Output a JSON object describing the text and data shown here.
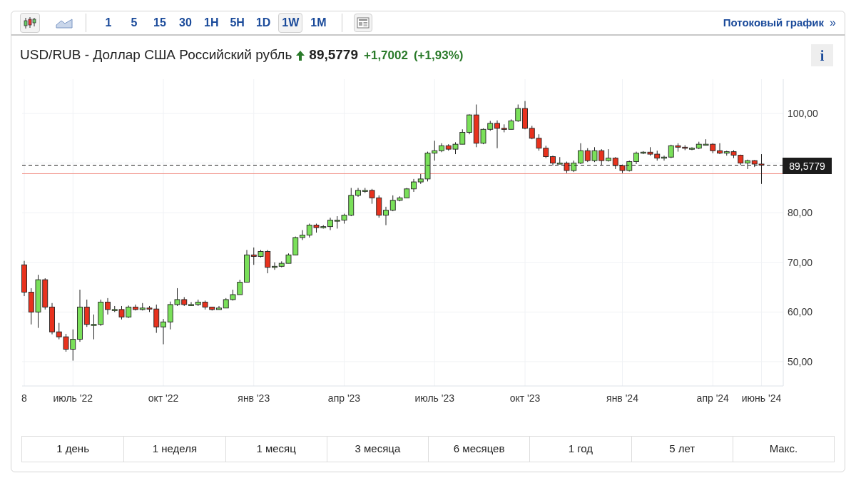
{
  "toolbar": {
    "chart_types": [
      {
        "kind": "candles",
        "selected": true
      },
      {
        "kind": "area",
        "selected": false
      }
    ],
    "intervals": [
      {
        "label": "1",
        "selected": false
      },
      {
        "label": "5",
        "selected": false
      },
      {
        "label": "15",
        "selected": false
      },
      {
        "label": "30",
        "selected": false
      },
      {
        "label": "1H",
        "selected": false
      },
      {
        "label": "5H",
        "selected": false
      },
      {
        "label": "1D",
        "selected": false
      },
      {
        "label": "1W",
        "selected": true
      },
      {
        "label": "1M",
        "selected": false
      }
    ],
    "streaming_link": {
      "label": "Потоковый график",
      "arrow": "»"
    }
  },
  "header": {
    "title": "USD/RUB - Доллар США Российский рубль",
    "rising": true,
    "price": "89,5779",
    "change": "+1,7002",
    "change_percent": "(+1,93%)",
    "info": "i"
  },
  "chart": {
    "price_label": "89,5779",
    "chart_data": {
      "type": "candlestick",
      "ylim": [
        45.1,
        106.9
      ],
      "grid": true,
      "ref_lines": [
        {
          "axis": "y",
          "value": 89.5779,
          "color": "#222222"
        },
        {
          "axis": "y",
          "value": 87.86,
          "color": "#f08a80"
        }
      ],
      "yticks": [
        {
          "value": 100,
          "label": "100,00"
        },
        {
          "value": 80,
          "label": "80,00"
        },
        {
          "value": 70,
          "label": "70,00"
        },
        {
          "value": 60,
          "label": "60,00"
        },
        {
          "value": 50,
          "label": "50,00"
        }
      ],
      "categories": [
        "8",
        null,
        null,
        null,
        null,
        null,
        null,
        "июль '22",
        null,
        null,
        null,
        null,
        null,
        null,
        null,
        null,
        null,
        null,
        null,
        null,
        "окт '22",
        null,
        null,
        null,
        null,
        null,
        null,
        null,
        null,
        null,
        null,
        null,
        null,
        "янв '23",
        null,
        null,
        null,
        null,
        null,
        null,
        null,
        null,
        null,
        null,
        null,
        null,
        "апр '23",
        null,
        null,
        null,
        null,
        null,
        null,
        null,
        null,
        null,
        null,
        null,
        null,
        "июль '23",
        null,
        null,
        null,
        null,
        null,
        null,
        null,
        null,
        null,
        null,
        null,
        null,
        "окт '23",
        null,
        null,
        null,
        null,
        null,
        null,
        null,
        null,
        null,
        null,
        null,
        null,
        null,
        "янв '24",
        null,
        null,
        null,
        null,
        null,
        null,
        null,
        null,
        null,
        null,
        null,
        null,
        "апр '24",
        null,
        null,
        null,
        null,
        null,
        null,
        "июнь '24"
      ],
      "ohlc": [
        [
          69.5,
          70.3,
          63.2,
          64
        ],
        [
          64,
          64.8,
          57.5,
          60
        ],
        [
          60,
          67.5,
          56.8,
          66.5
        ],
        [
          66.5,
          66.8,
          60.5,
          61
        ],
        [
          61,
          61.8,
          55.5,
          56
        ],
        [
          56,
          57.8,
          54.5,
          55
        ],
        [
          55,
          55.6,
          52,
          52.5
        ],
        [
          52.5,
          56.5,
          50.2,
          54.5
        ],
        [
          54.5,
          64.5,
          54,
          61
        ],
        [
          61,
          62.5,
          57,
          57.5
        ],
        [
          57.5,
          59.5,
          54.5,
          57.5
        ],
        [
          57.5,
          62.5,
          57.2,
          62
        ],
        [
          62,
          62.8,
          59.5,
          60.5
        ],
        [
          60.5,
          61.2,
          60,
          60.5
        ],
        [
          60.5,
          61.2,
          58.5,
          59
        ],
        [
          59,
          61.3,
          58.8,
          61
        ],
        [
          61,
          61.5,
          60.3,
          60.5
        ],
        [
          60.5,
          61.8,
          60.3,
          60.8
        ],
        [
          60.8,
          61.2,
          60,
          60.6
        ],
        [
          60.6,
          61.5,
          55.8,
          57
        ],
        [
          57,
          58.6,
          53.5,
          58
        ],
        [
          58,
          62.1,
          56.5,
          61.5
        ],
        [
          61.5,
          64.8,
          61.2,
          62.5
        ],
        [
          62.5,
          63,
          61.2,
          61.5
        ],
        [
          61.5,
          62,
          61.2,
          61.5
        ],
        [
          61.5,
          62.5,
          61.2,
          62
        ],
        [
          62,
          62.3,
          60.5,
          61
        ],
        [
          61,
          61,
          60.3,
          60.5
        ],
        [
          60.5,
          61.2,
          60.5,
          60.8
        ],
        [
          60.8,
          62.8,
          60.8,
          62.5
        ],
        [
          62.5,
          64.5,
          62.3,
          63.5
        ],
        [
          63.5,
          66.5,
          63.5,
          66
        ],
        [
          66,
          72.5,
          66,
          71.5
        ],
        [
          71.5,
          73,
          69.5,
          71.2
        ],
        [
          71.2,
          72.5,
          71,
          72.2
        ],
        [
          72.2,
          72.5,
          67.8,
          69
        ],
        [
          69,
          70,
          68.5,
          69.2
        ],
        [
          69.2,
          70.2,
          69,
          69.8
        ],
        [
          69.8,
          71.8,
          69.8,
          71.5
        ],
        [
          71.5,
          75.2,
          71.5,
          75
        ],
        [
          75,
          76.5,
          74.5,
          75.5
        ],
        [
          75.5,
          77.8,
          75,
          77.5
        ],
        [
          77.5,
          77.8,
          76,
          77
        ],
        [
          77,
          77.5,
          76.8,
          77.2
        ],
        [
          77.2,
          79,
          76.5,
          78.5
        ],
        [
          78.5,
          79.3,
          76.8,
          78.5
        ],
        [
          78.5,
          79.8,
          77.8,
          79.5
        ],
        [
          79.5,
          85,
          79.3,
          83.5
        ],
        [
          83.5,
          85,
          83.2,
          84.5
        ],
        [
          84.5,
          85,
          84,
          84.5
        ],
        [
          84.5,
          84.8,
          81.8,
          83
        ],
        [
          83,
          83.5,
          79,
          79.5
        ],
        [
          79.5,
          81.2,
          77.5,
          80.5
        ],
        [
          80.5,
          83.5,
          80.3,
          82.5
        ],
        [
          82.5,
          83.3,
          82.3,
          83
        ],
        [
          83,
          85,
          83,
          84.8
        ],
        [
          84.8,
          86.8,
          84.2,
          86.2
        ],
        [
          86.2,
          87.8,
          85.8,
          86.8
        ],
        [
          86.8,
          92.3,
          86.3,
          92
        ],
        [
          92,
          94.5,
          90.5,
          92.5
        ],
        [
          92.5,
          94,
          92.2,
          93.5
        ],
        [
          93.5,
          93.8,
          92.5,
          92.8
        ],
        [
          92.8,
          94.2,
          91.8,
          93.8
        ],
        [
          93.8,
          96.8,
          93.8,
          96.2
        ],
        [
          96.2,
          99.8,
          95.8,
          99.7
        ],
        [
          99.7,
          101.8,
          93.2,
          94
        ],
        [
          94,
          97,
          93.8,
          96.8
        ],
        [
          96.8,
          98.5,
          96.5,
          98
        ],
        [
          98,
          98.6,
          93,
          97
        ],
        [
          97,
          97.8,
          96.2,
          96.8
        ],
        [
          96.8,
          98.8,
          96.8,
          98.5
        ],
        [
          98.5,
          101.8,
          98.3,
          101
        ],
        [
          101,
          102.5,
          96.8,
          97
        ],
        [
          97,
          97.5,
          94.8,
          95
        ],
        [
          95,
          95.8,
          92.5,
          93
        ],
        [
          93,
          93.5,
          91,
          91.3
        ],
        [
          91.3,
          91.5,
          89.5,
          90
        ],
        [
          90,
          91.2,
          89.8,
          90
        ],
        [
          90,
          90.3,
          88,
          88.5
        ],
        [
          88.5,
          90.5,
          88.2,
          90
        ],
        [
          90,
          94,
          89.8,
          92.5
        ],
        [
          92.5,
          93,
          90.2,
          90.5
        ],
        [
          90.5,
          93.2,
          90.2,
          92.5
        ],
        [
          92.5,
          92.8,
          89.5,
          90.5
        ],
        [
          90.5,
          92.8,
          90.3,
          91
        ],
        [
          91,
          91.2,
          88.8,
          89.5
        ],
        [
          89.5,
          89.7,
          88,
          88.5
        ],
        [
          88.5,
          90.5,
          88.3,
          90.3
        ],
        [
          90.3,
          92.3,
          89.8,
          92
        ],
        [
          92,
          92.4,
          91.8,
          92.2
        ],
        [
          92.2,
          93.2,
          91.5,
          91.8
        ],
        [
          91.8,
          92.5,
          90.5,
          91
        ],
        [
          91,
          91.5,
          90.5,
          91.2
        ],
        [
          91.2,
          93.7,
          91,
          93.5
        ],
        [
          93.5,
          94,
          92.3,
          93.2
        ],
        [
          93.2,
          93.6,
          92.6,
          93
        ],
        [
          93,
          93.2,
          92.6,
          93
        ],
        [
          93,
          94.3,
          92.8,
          93.8
        ],
        [
          93.8,
          94.8,
          93.6,
          93.8
        ],
        [
          93.8,
          94,
          92,
          92.5
        ],
        [
          92.5,
          94,
          91.8,
          92
        ],
        [
          92,
          92.5,
          91.5,
          92.3
        ],
        [
          92.3,
          92.6,
          91,
          91.6
        ],
        [
          91.6,
          91.7,
          89.6,
          90
        ],
        [
          90,
          90.7,
          88.8,
          90.5
        ],
        [
          90.5,
          90.6,
          89.2,
          89.8
        ],
        [
          89.8,
          91.8,
          85.8,
          89.58
        ]
      ]
    }
  },
  "ranges": [
    {
      "label": "1 день",
      "selected": false
    },
    {
      "label": "1 неделя",
      "selected": false
    },
    {
      "label": "1 месяц",
      "selected": false
    },
    {
      "label": "3 месяца",
      "selected": false
    },
    {
      "label": "6 месяцев",
      "selected": false
    },
    {
      "label": "1 год",
      "selected": false
    },
    {
      "label": "5 лет",
      "selected": false
    },
    {
      "label": "Макс.",
      "selected": false
    }
  ]
}
